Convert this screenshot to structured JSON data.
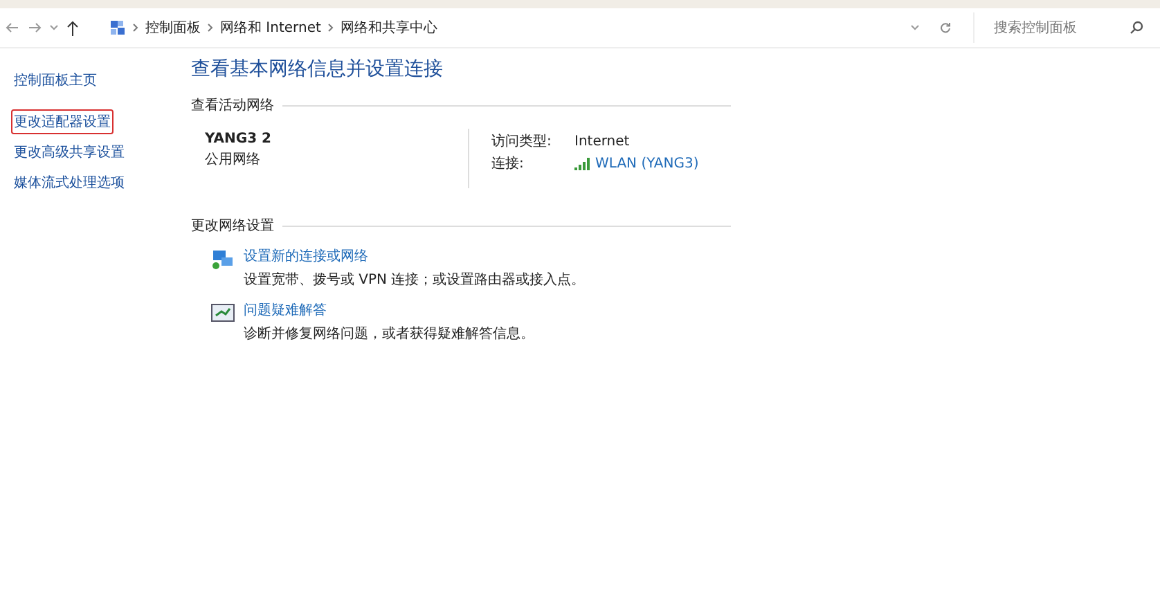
{
  "address_bar": {
    "path": [
      {
        "label": "控制面板"
      },
      {
        "label": "网络和 Internet"
      },
      {
        "label": "网络和共享中心"
      }
    ],
    "search": {
      "placeholder": "搜索控制面板"
    }
  },
  "sidebar": {
    "items": [
      {
        "label": "控制面板主页",
        "highlighted": false
      },
      {
        "label": "更改适配器设置",
        "highlighted": true
      },
      {
        "label": "更改高级共享设置",
        "highlighted": false
      },
      {
        "label": "媒体流式处理选项",
        "highlighted": false
      }
    ]
  },
  "main": {
    "title": "查看基本网络信息并设置连接",
    "active_networks": {
      "heading": "查看活动网络",
      "network_name": "YANG3 2",
      "network_type": "公用网络",
      "access_type_label": "访问类型:",
      "access_type": "Internet",
      "connection_label": "连接:",
      "connection": "WLAN (YANG3)"
    },
    "change_settings": {
      "heading": "更改网络设置",
      "items": [
        {
          "kind": "setup",
          "link": "设置新的连接或网络",
          "description": "设置宽带、拨号或 VPN 连接；或设置路由器或接入点。"
        },
        {
          "kind": "troubleshoot",
          "link": "问题疑难解答",
          "description": "诊断并修复网络问题，或者获得疑难解答信息。"
        }
      ]
    }
  }
}
